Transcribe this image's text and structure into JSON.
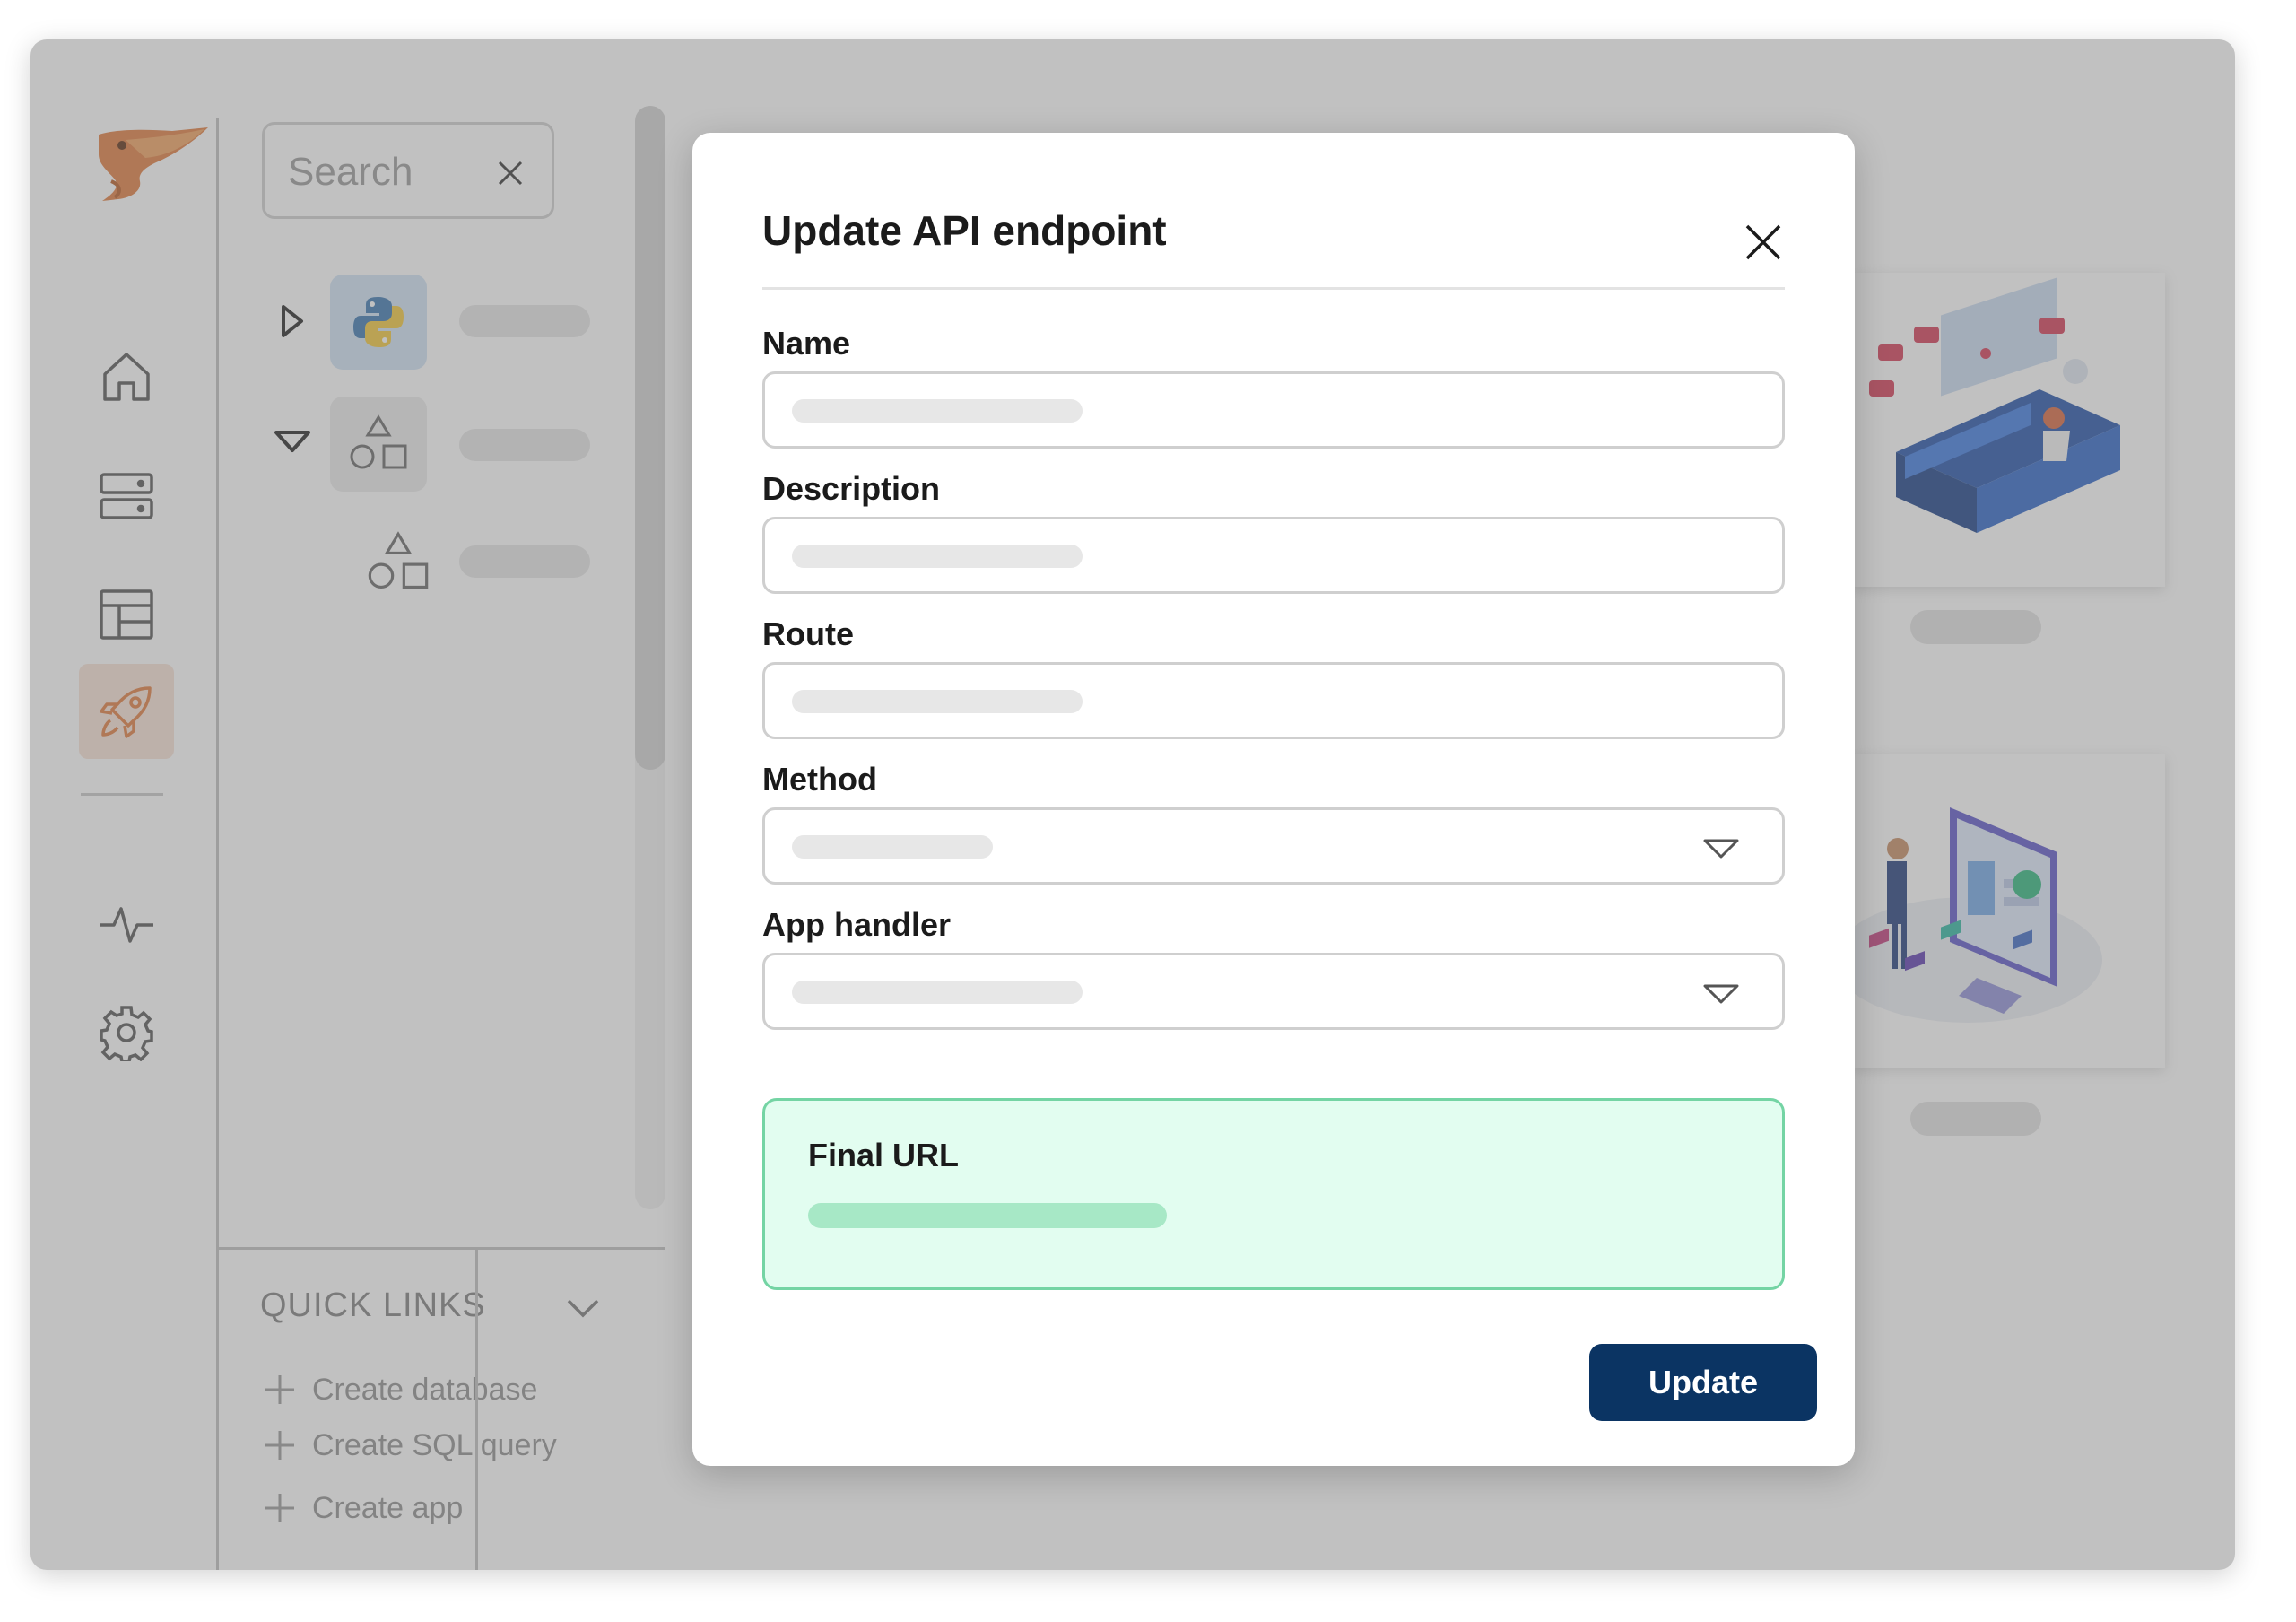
{
  "sidebar": {
    "icons": [
      "home-icon",
      "server-icon",
      "table-icon",
      "rocket-icon",
      "activity-icon",
      "gear-icon"
    ],
    "active_icon": "rocket-icon",
    "accent_color": "#e07a3c"
  },
  "tree": {
    "search_placeholder": "Search",
    "nodes": [
      {
        "icon": "python-icon",
        "expanded": false
      },
      {
        "icon": "shapes-icon",
        "expanded": true
      },
      {
        "icon": "shapes-icon",
        "expanded": false
      }
    ]
  },
  "quick_links": {
    "title": "QUICK LINKS",
    "items": [
      {
        "label": "Create database"
      },
      {
        "label": "Create SQL query"
      },
      {
        "label": "Create app"
      }
    ]
  },
  "modal": {
    "title": "Update API endpoint",
    "fields": {
      "name_label": "Name",
      "description_label": "Description",
      "route_label": "Route",
      "method_label": "Method",
      "app_handler_label": "App handler"
    },
    "final_url_label": "Final URL",
    "update_label": "Update",
    "colors": {
      "primary": "#0b3463",
      "success_border": "#74d4a4",
      "success_bg": "#e2fdf0"
    }
  }
}
